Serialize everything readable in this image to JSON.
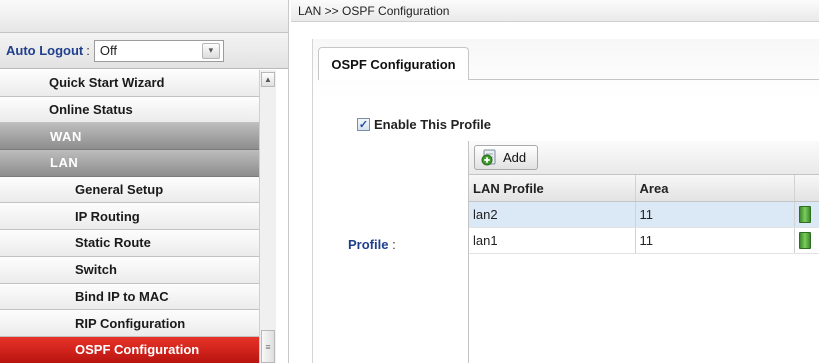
{
  "sidebar": {
    "auto_logout": {
      "label": "Auto Logout",
      "colon": ":",
      "value": "Off",
      "arrow": "▾"
    },
    "menu": [
      {
        "label": "Quick Start Wizard"
      },
      {
        "label": "Online Status"
      },
      {
        "label": "WAN"
      },
      {
        "label": "LAN"
      },
      {
        "label": "General Setup"
      },
      {
        "label": "IP Routing"
      },
      {
        "label": "Static Route"
      },
      {
        "label": "Switch"
      },
      {
        "label": "Bind IP to MAC"
      },
      {
        "label": "RIP Configuration"
      },
      {
        "label": "OSPF Configuration"
      }
    ],
    "scroll_up": "▲",
    "scroll_grip": "≡"
  },
  "main": {
    "breadcrumb": "LAN >> OSPF Configuration",
    "tab": "OSPF Configuration",
    "enable": {
      "checkmark": "✓",
      "label": "Enable This Profile"
    },
    "profile": {
      "label": "Profile",
      "colon": ":"
    },
    "grid": {
      "add_label": "Add",
      "columns": [
        "LAN Profile",
        "Area"
      ],
      "rows": [
        {
          "profile": "lan2",
          "area": "11"
        },
        {
          "profile": "lan1",
          "area": "11"
        }
      ]
    }
  },
  "colors": {
    "active_menu": "#cc2019",
    "section_grey": "#9a9a9a",
    "label_blue": "#1f3f8e",
    "selected_row": "#dbe8f6"
  },
  "icons": [
    "chevron-down-icon",
    "add-icon",
    "trash-icon",
    "scroll-up-arrow-icon",
    "checkbox-checked-icon"
  ]
}
